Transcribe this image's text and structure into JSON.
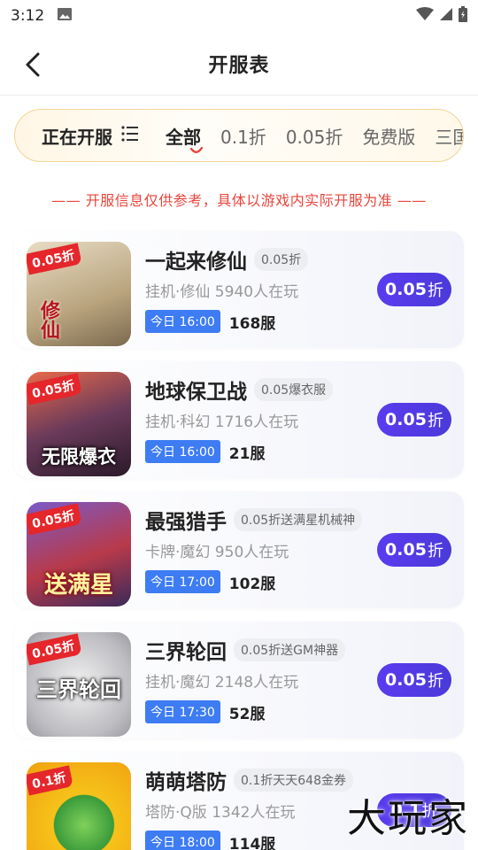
{
  "status_bar": {
    "time": "3:12"
  },
  "header": {
    "title": "开服表"
  },
  "filter": {
    "main_label": "正在开服",
    "tabs": [
      "全部",
      "0.1折",
      "0.05折",
      "免费版",
      "三国"
    ]
  },
  "notice": "—— 开服信息仅供参考，具体以游戏内实际开服为准 ——",
  "games": [
    {
      "name": "一起来修仙",
      "badge": "0.05折",
      "meta": "挂机·修仙  5940人在玩",
      "time": "今日 16:00",
      "server": "168服",
      "discount": "0.05",
      "discount_unit": "折",
      "thumb_tag": "0.05折",
      "thumb_text": "修仙",
      "thumb_bg": "#c9b99a"
    },
    {
      "name": "地球保卫战",
      "badge": "0.05爆衣服",
      "meta": "挂机·科幻  1716人在玩",
      "time": "今日 16:00",
      "server": "21服",
      "discount": "0.05",
      "discount_unit": "折",
      "thumb_tag": "0.05折",
      "thumb_text": "无限爆衣",
      "thumb_bg": "#5a3a4a"
    },
    {
      "name": "最强猎手",
      "badge": "0.05折送满星机械神",
      "meta": "卡牌·魔幻  950人在玩",
      "time": "今日 17:00",
      "server": "102服",
      "discount": "0.05",
      "discount_unit": "折",
      "thumb_tag": "0.05折",
      "thumb_text": "送满星",
      "thumb_bg": "#4a3a7a"
    },
    {
      "name": "三界轮回",
      "badge": "0.05折送GM神器",
      "meta": "挂机·魔幻  2148人在玩",
      "time": "今日 17:30",
      "server": "52服",
      "discount": "0.05",
      "discount_unit": "折",
      "thumb_tag": "0.05折",
      "thumb_text": "三界轮回",
      "thumb_bg": "#cfcfd2"
    },
    {
      "name": "萌萌塔防",
      "badge": "0.1折天天648金券",
      "meta": "塔防·Q版  1342人在玩",
      "time": "今日 18:00",
      "server": "114服",
      "discount": "0.1",
      "discount_unit": "折",
      "thumb_tag": "0.1折",
      "thumb_text": "",
      "thumb_bg": "#f6c21a"
    }
  ],
  "watermark": "大玩家"
}
